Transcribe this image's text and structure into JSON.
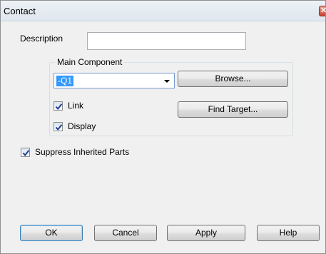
{
  "window": {
    "title": "Contact"
  },
  "description": {
    "label": "Description",
    "value": ""
  },
  "main_component": {
    "group_label": "Main Component",
    "selected_value": "-Q1",
    "browse_label": "Browse...",
    "find_target_label": "Find Target...",
    "link": {
      "label": "Link",
      "checked": true
    },
    "display": {
      "label": "Display",
      "checked": true
    }
  },
  "suppress_inherited_parts": {
    "label": "Suppress Inherited Parts",
    "checked": true
  },
  "buttons": {
    "ok": "OK",
    "cancel": "Cancel",
    "apply": "Apply",
    "help": "Help"
  },
  "colors": {
    "selection": "#3399ff",
    "checkmark": "#1c3f94",
    "close": "#c9412e"
  }
}
